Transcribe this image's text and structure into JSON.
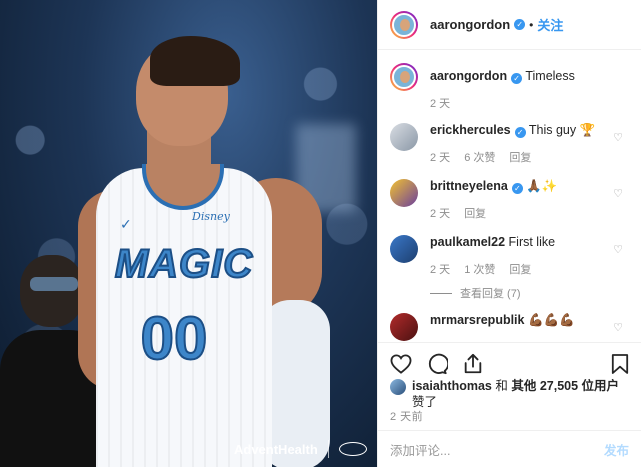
{
  "photo": {
    "jersey_team": "MAGIC",
    "jersey_number": "00",
    "jersey_maker": "✓",
    "jersey_sponsor": "Disney",
    "sponsor_text": "AdventHealth"
  },
  "header": {
    "username": "aarongordon",
    "follow_label": "关注",
    "separator": "•"
  },
  "caption": {
    "username": "aarongordon",
    "text": "Timeless",
    "time": "2 天"
  },
  "comments": [
    {
      "username": "erickhercules",
      "verified": true,
      "text": "This guy 🏆",
      "time": "2 天",
      "likes": "6 次赞",
      "reply": "回复"
    },
    {
      "username": "brittneyelena",
      "verified": true,
      "text": "🙏🏾✨",
      "time": "2 天",
      "reply": "回复"
    },
    {
      "username": "paulkamel22",
      "verified": false,
      "text": "First like",
      "time": "2 天",
      "likes": "1 次赞",
      "reply": "回复",
      "view_replies": "查看回复 (7)"
    },
    {
      "username": "mrmarsrepublik",
      "verified": false,
      "text": "💪🏾💪🏾💪🏾"
    }
  ],
  "likes": {
    "liker": "isaiahthomas",
    "connector": " 和 ",
    "others": "其他 27,505 位用户",
    "suffix": "赞了"
  },
  "posted_time": "2 天前",
  "comment_box": {
    "placeholder": "添加评论...",
    "post_label": "发布"
  },
  "icons": {
    "verified": "verified-badge",
    "heart": "heart-outline",
    "comment": "speech-bubble",
    "share": "share-arrow",
    "save": "bookmark"
  },
  "colors": {
    "accent": "#3897f0",
    "text": "#262626",
    "muted": "#8e8e8e",
    "post_disabled": "#b3dbff"
  }
}
